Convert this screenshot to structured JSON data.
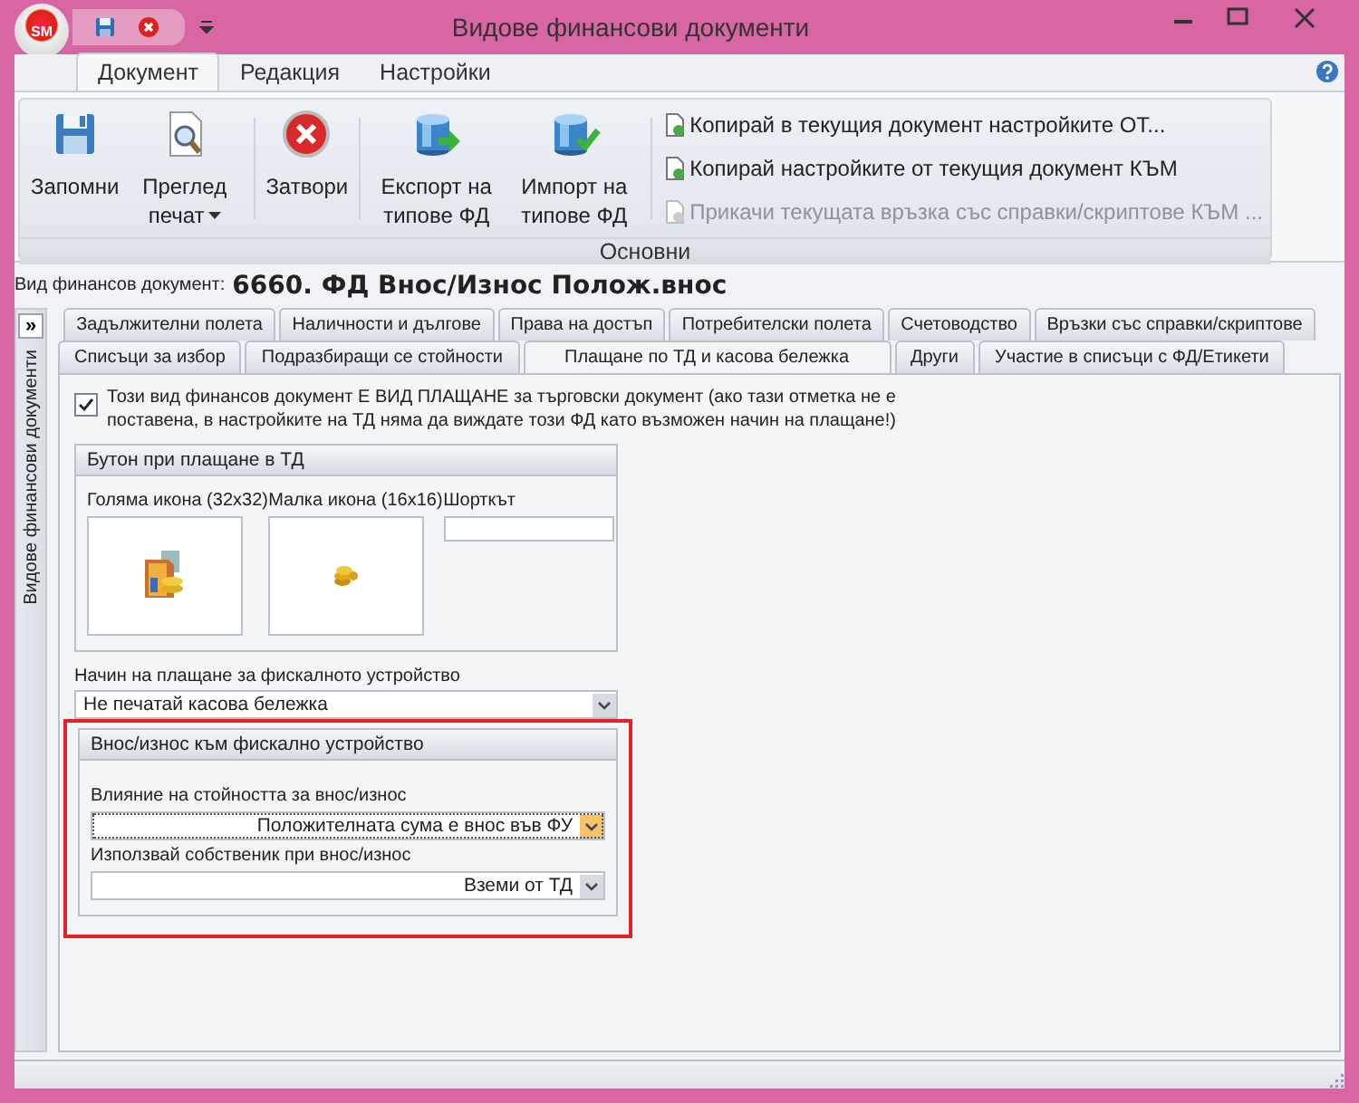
{
  "window": {
    "title": "Видове финансови документи",
    "app_badge": "SM"
  },
  "ribbon": {
    "tabs": [
      {
        "label": "Документ",
        "selected": true
      },
      {
        "label": "Редакция",
        "selected": false
      },
      {
        "label": "Настройки",
        "selected": false
      }
    ],
    "large_buttons": [
      {
        "kind": "save",
        "label": "Запомни",
        "has_menu": false
      },
      {
        "kind": "preview",
        "label": "Преглед печат",
        "has_menu": true
      },
      {
        "kind": "close",
        "label": "Затвори",
        "has_menu": false
      },
      {
        "kind": "export",
        "label": "Експорт на типове ФД",
        "has_menu": false
      },
      {
        "kind": "import",
        "label": "Импорт на типове ФД",
        "has_menu": false
      }
    ],
    "small_buttons": [
      {
        "label": "Копирай в текущия документ настройките ОТ...",
        "disabled": false
      },
      {
        "label": "Копирай настройките от текущия документ КЪМ",
        "disabled": false
      },
      {
        "label": "Прикачи текущата връзка със справки/скриптове КЪМ ...",
        "disabled": true
      }
    ],
    "group_label": "Основни"
  },
  "document": {
    "label": "Вид финансов документ:",
    "value": "6660. ФД Внос/Износ Полож.внос"
  },
  "side_panel": {
    "expand_glyph": "»",
    "title": "Видове финансови документи"
  },
  "tab_rows": [
    [
      {
        "label": "Задължителни полета",
        "selected": false
      },
      {
        "label": "Наличности и дългове",
        "selected": false
      },
      {
        "label": "Права на достъп",
        "selected": false
      },
      {
        "label": "Потребителски полета",
        "selected": false
      },
      {
        "label": "Счетоводство",
        "selected": false
      },
      {
        "label": "Връзки със справки/скриптове",
        "selected": false
      }
    ],
    [
      {
        "label": "Списъци за избор",
        "selected": false
      },
      {
        "label": "Подразбиращи се стойности",
        "selected": false
      },
      {
        "label": "Плащане по ТД и касова бележка",
        "selected": true
      },
      {
        "label": "Други",
        "selected": false
      },
      {
        "label": "Участие в списъци с ФД/Етикети",
        "selected": false
      }
    ]
  ],
  "payment": {
    "checkbox": {
      "checked": true,
      "label": "Този вид финансов документ Е ВИД ПЛАЩАНЕ за търговски документ (ако тази отметка не е поставена, в настройките на ТД няма да виждате този ФД като възможен начин на плащане!)"
    },
    "button_group": {
      "title": "Бутон при плащане в ТД",
      "large_icon_label": "Голяма икона (32x32)",
      "small_icon_label": "Малка икона (16x16)",
      "shortcut_label": "Шорткът"
    },
    "fiscal_method": {
      "label": "Начин на плащане за фискалното устройство",
      "value": "Не печатай касова бележка"
    },
    "cash_group": {
      "title": "Внос/износ към фискално устройство",
      "highlighted": true,
      "fields": [
        {
          "label": "Влияние на стойността за внос/износ",
          "value": "Положителната сума е внос във ФУ",
          "focused": true
        },
        {
          "label": "Използвай собственик при внос/износ",
          "value": "Вземи от ТД",
          "focused": false
        }
      ]
    }
  }
}
